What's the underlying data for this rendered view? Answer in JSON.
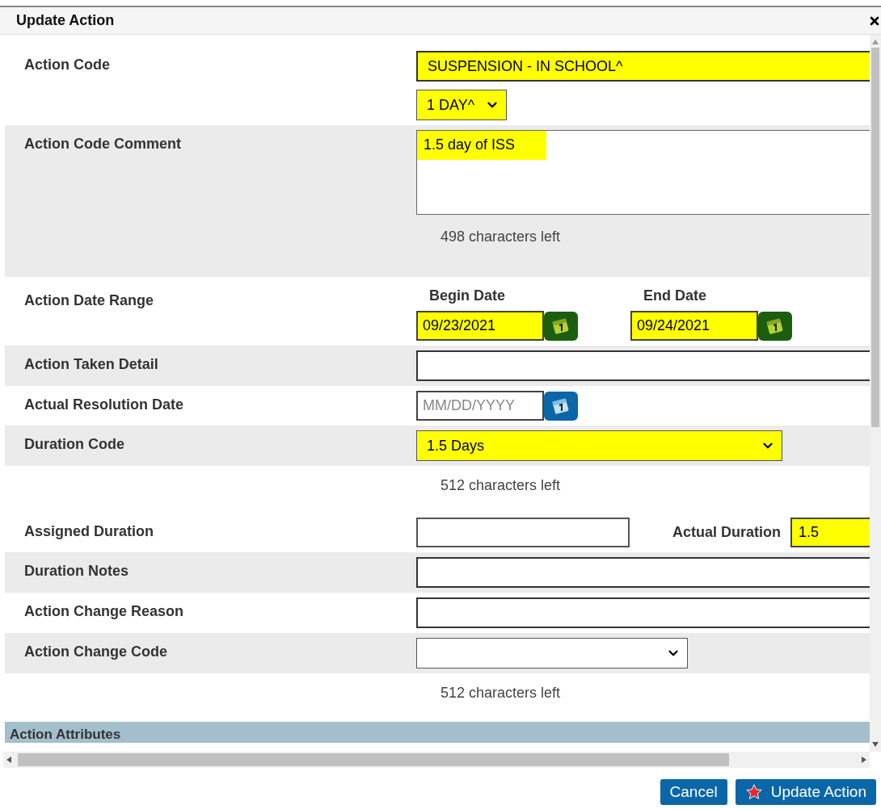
{
  "dialog": {
    "title": "Update Action"
  },
  "rows": [
    {
      "label": "Action Code",
      "shaded": false,
      "controls": [
        {
          "kind": "wide_text",
          "value": "SUSPENSION - IN SCHOOL^",
          "highlighted": true
        },
        {
          "kind": "small_select",
          "value": "1 DAY^",
          "highlighted": true
        }
      ]
    },
    {
      "label": "Action Code Comment",
      "shaded": true,
      "controls": [
        {
          "kind": "textarea",
          "value": "1.5 day of ISS",
          "highlighted": true
        },
        {
          "kind": "note",
          "text": "498 characters left"
        }
      ]
    },
    {
      "label": "Action Date Range",
      "shaded": false,
      "controls": [
        {
          "kind": "date",
          "heading": "Begin Date",
          "value": "09/23/2021",
          "highlighted": true
        },
        {
          "kind": "date",
          "heading": "End Date",
          "value": "09/24/2021",
          "highlighted": true
        }
      ]
    },
    {
      "label": "Action Taken Detail",
      "shaded": true,
      "controls": [
        {
          "kind": "wide_text",
          "highlighted": false
        }
      ]
    },
    {
      "label": "Actual Resolution Date",
      "shaded": false,
      "controls": [
        {
          "kind": "date",
          "placeholder": "MM/DD/YYYY",
          "highlighted": false
        }
      ]
    },
    {
      "label": "Duration Code",
      "shaded": true,
      "controls": [
        {
          "kind": "large_select",
          "value": "1.5 Days",
          "highlighted": true
        }
      ]
    },
    {
      "shaded": false,
      "controls": [
        {
          "kind": "note",
          "text": "512 characters left"
        }
      ]
    },
    {
      "label": "Assigned Duration",
      "shaded": false,
      "controls": [
        {
          "kind": "short_text",
          "highlighted": false
        },
        {
          "kind": "labeled_text",
          "label": "Actual Duration",
          "value": "1.5",
          "highlighted": true
        }
      ]
    },
    {
      "label": "Duration Notes",
      "shaded": true,
      "controls": [
        {
          "kind": "wide_text",
          "highlighted": false
        }
      ]
    },
    {
      "label": "Action Change Reason",
      "shaded": false,
      "controls": [
        {
          "kind": "wide_text",
          "highlighted": false
        }
      ]
    },
    {
      "label": "Action Change Code",
      "shaded": true,
      "controls": [
        {
          "kind": "medium_select",
          "highlighted": false
        }
      ]
    },
    {
      "shaded": false,
      "controls": [
        {
          "kind": "note",
          "text": "512 characters left"
        }
      ]
    }
  ],
  "section_header": "Action Attributes",
  "buttons": [
    {
      "label": "Cancel",
      "kind": "cancel"
    },
    {
      "label": "Update Action",
      "kind": "submit"
    }
  ]
}
